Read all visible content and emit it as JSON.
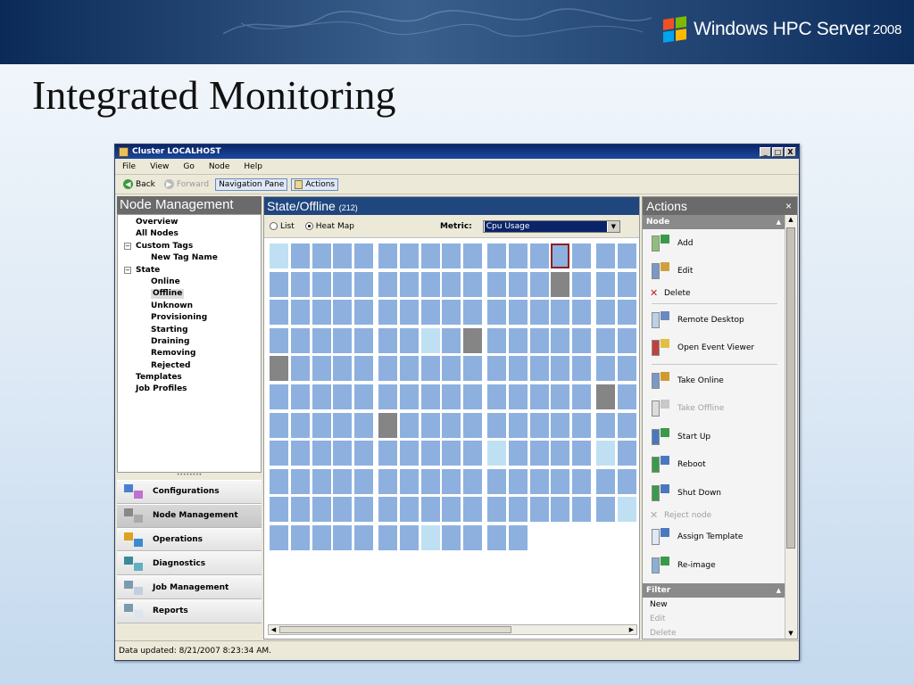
{
  "slide": {
    "title": "Integrated Monitoring",
    "brand_name": "Windows HPC Server",
    "brand_version": "2008"
  },
  "window": {
    "title": "Cluster LOCALHOST",
    "controls": [
      "_",
      "□",
      "X"
    ],
    "menu": [
      "File",
      "View",
      "Go",
      "Node",
      "Help"
    ],
    "toolbar": {
      "back": "Back",
      "forward": "Forward",
      "navigation_pane": "Navigation Pane",
      "actions": "Actions"
    },
    "status_text": "Data updated: 8/21/2007 8:23:34 AM."
  },
  "left_pane": {
    "title": "Node Management",
    "tree": [
      {
        "label": "Overview",
        "level": 1
      },
      {
        "label": "All Nodes",
        "level": 1
      },
      {
        "label": "Custom Tags",
        "level": 1,
        "expander": "⊟"
      },
      {
        "label": "New Tag Name",
        "level": 2
      },
      {
        "label": "State",
        "level": 1,
        "expander": "⊟"
      },
      {
        "label": "Online",
        "level": 2
      },
      {
        "label": "Offline",
        "level": 2,
        "selected": true
      },
      {
        "label": "Unknown",
        "level": 2
      },
      {
        "label": "Provisioning",
        "level": 2
      },
      {
        "label": "Starting",
        "level": 2
      },
      {
        "label": "Draining",
        "level": 2
      },
      {
        "label": "Removing",
        "level": 2
      },
      {
        "label": "Rejected",
        "level": 2
      },
      {
        "label": "Templates",
        "level": 1
      },
      {
        "label": "Job Profiles",
        "level": 1
      }
    ],
    "nav_buttons": [
      {
        "label": "Configurations",
        "icon": "configurations-icon"
      },
      {
        "label": "Node Management",
        "icon": "node-management-icon",
        "active": true
      },
      {
        "label": "Operations",
        "icon": "operations-icon"
      },
      {
        "label": "Diagnostics",
        "icon": "diagnostics-icon"
      },
      {
        "label": "Job Management",
        "icon": "job-management-icon"
      },
      {
        "label": "Reports",
        "icon": "reports-icon"
      }
    ]
  },
  "center_pane": {
    "title": "State/Offline",
    "count": "(212)",
    "view_list": "List",
    "view_heatmap": "Heat Map",
    "selected_view": "Heat Map",
    "metric_label": "Metric:",
    "metric_value": "Cpu Usage",
    "heatmap": {
      "columns": 17,
      "rows": 11,
      "last_row_count": 12,
      "colors": {
        "normal": "#8db0df",
        "offline": "#858585",
        "light": "#bfe0f2",
        "highlight_border": "#8a2222"
      },
      "offline_cells": [
        [
          1,
          13
        ],
        [
          3,
          9
        ],
        [
          4,
          0
        ],
        [
          5,
          15
        ],
        [
          6,
          5
        ]
      ],
      "light_cells": [
        [
          0,
          0
        ],
        [
          3,
          7
        ],
        [
          7,
          10
        ],
        [
          7,
          15
        ],
        [
          9,
          16
        ],
        [
          10,
          7
        ]
      ],
      "highlighted_cell": [
        0,
        13
      ]
    }
  },
  "actions_pane": {
    "title": "Actions",
    "close": "×",
    "node_section": "Node",
    "items": [
      {
        "label": "Add",
        "icon": "add-icon",
        "size": "large"
      },
      {
        "label": "Edit",
        "icon": "edit-icon",
        "size": "large"
      },
      {
        "label": "Delete",
        "icon": "delete-icon",
        "size": "small"
      },
      {
        "label": "Remote Desktop",
        "icon": "remote-desktop-icon",
        "size": "large",
        "sep_before": true
      },
      {
        "label": "Open Event Viewer",
        "icon": "event-viewer-icon",
        "size": "large"
      },
      {
        "label": "Take Online",
        "icon": "take-online-icon",
        "size": "large",
        "sep_before": true
      },
      {
        "label": "Take Offline",
        "icon": "take-offline-icon",
        "size": "large",
        "disabled": true
      },
      {
        "label": "Start Up",
        "icon": "start-up-icon",
        "size": "large"
      },
      {
        "label": "Reboot",
        "icon": "reboot-icon",
        "size": "large"
      },
      {
        "label": "Shut Down",
        "icon": "shut-down-icon",
        "size": "large"
      },
      {
        "label": "Reject node",
        "icon": "reject-icon",
        "size": "small",
        "disabled": true
      },
      {
        "label": "Assign Template",
        "icon": "assign-template-icon",
        "size": "large"
      },
      {
        "label": "Re-image",
        "icon": "reimage-icon",
        "size": "large"
      }
    ],
    "filter_section": "Filter",
    "filter_items": [
      {
        "label": "New"
      },
      {
        "label": "Edit",
        "disabled": true
      },
      {
        "label": "Delete",
        "disabled": true
      }
    ]
  }
}
